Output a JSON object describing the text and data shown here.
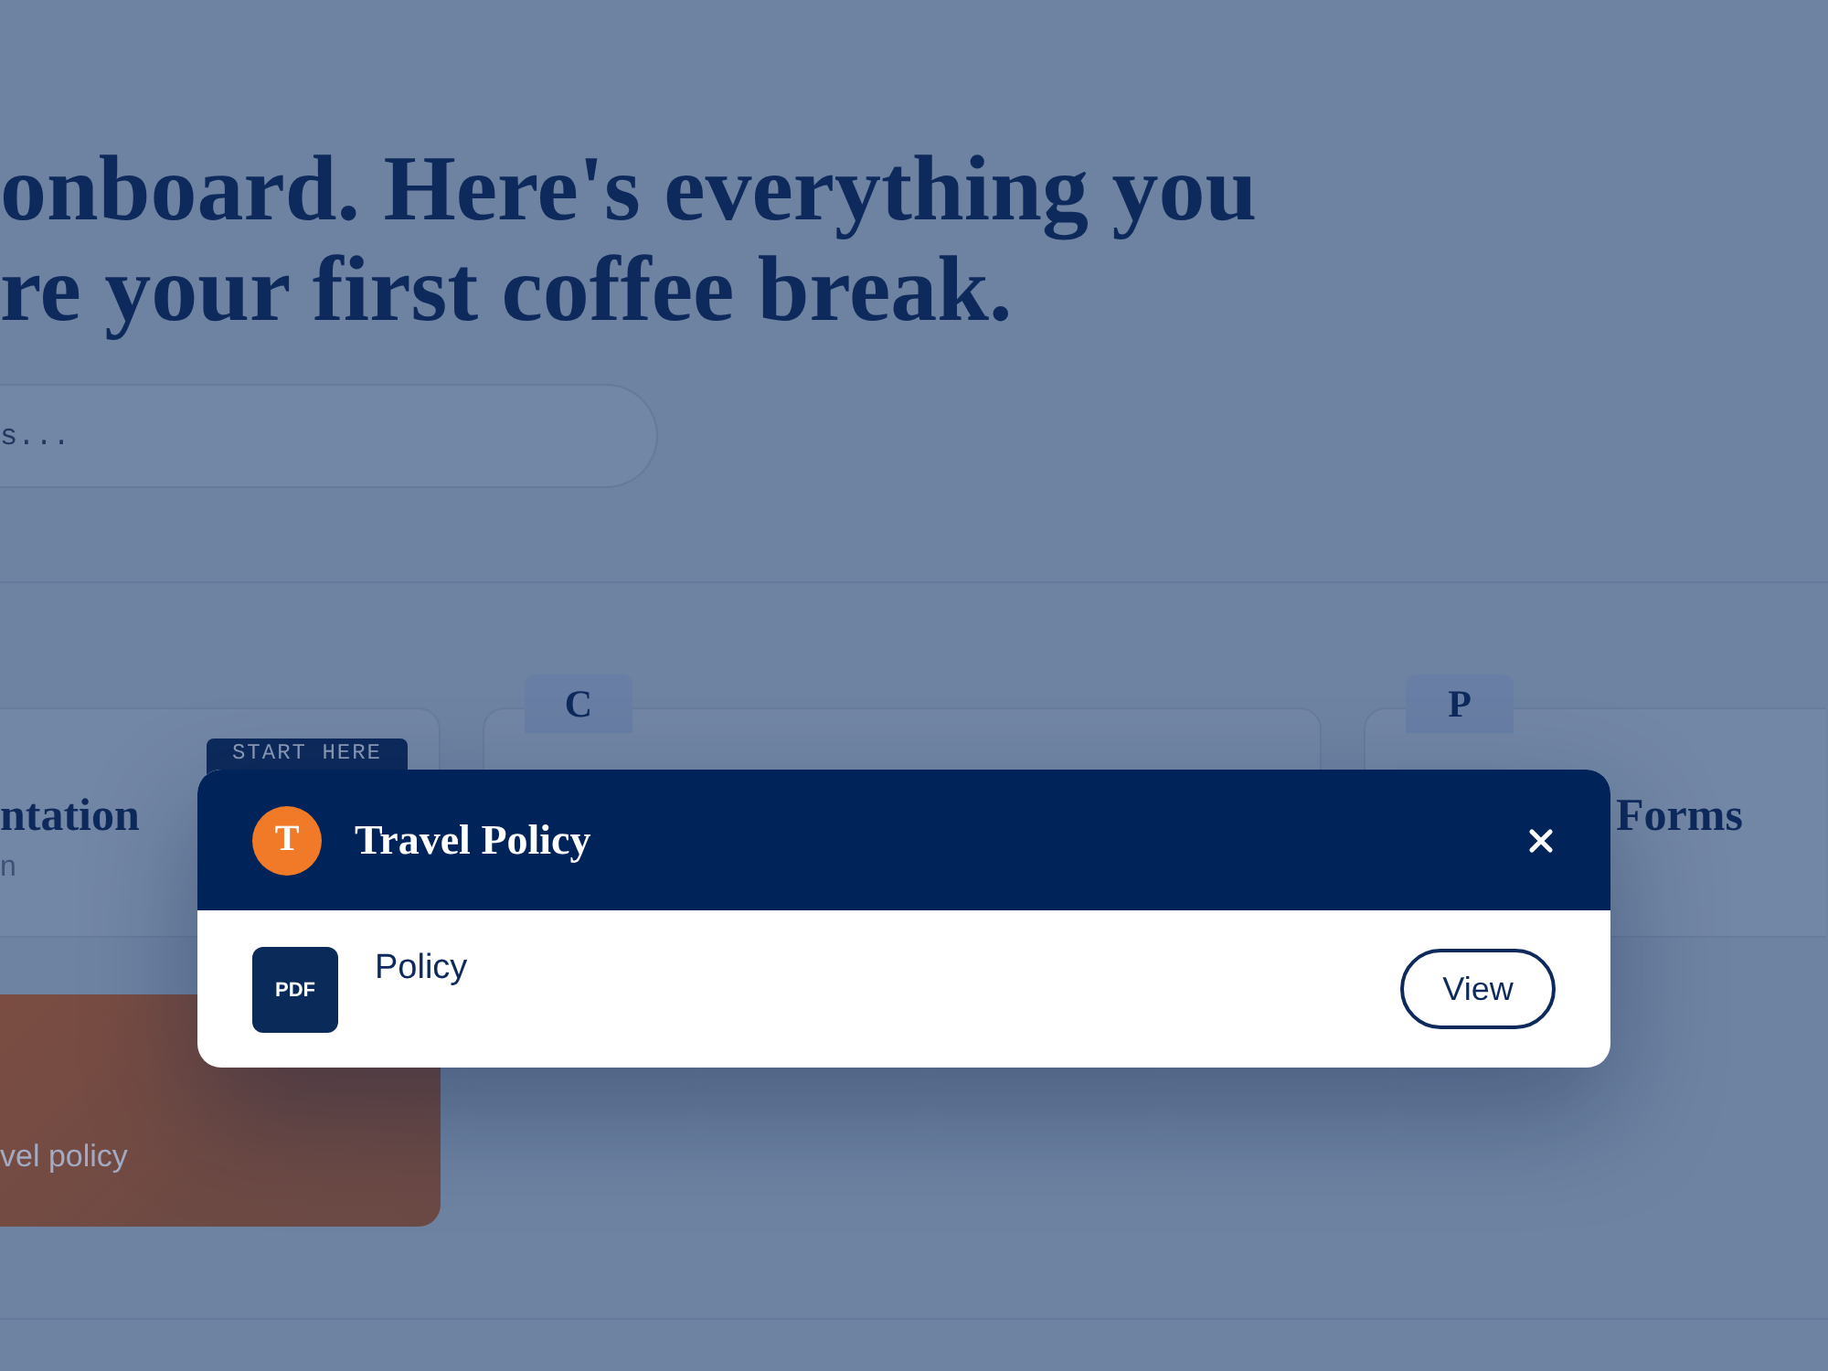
{
  "page": {
    "heading_lines": [
      "onboard. Here's everything you",
      "re your first coffee break."
    ],
    "search": {
      "placeholder": "s..."
    }
  },
  "cards": [
    {
      "badge": "START HERE",
      "title": "ntation",
      "subtitle": "n"
    },
    {
      "tab": "C"
    },
    {
      "tab": "P",
      "title": "Forms"
    }
  ],
  "highlight_card": {
    "text": "vel policy"
  },
  "modal": {
    "avatar_letter": "T",
    "title": "Travel Policy",
    "items": [
      {
        "file_type": "PDF",
        "name": "Policy",
        "action": "View"
      }
    ]
  }
}
